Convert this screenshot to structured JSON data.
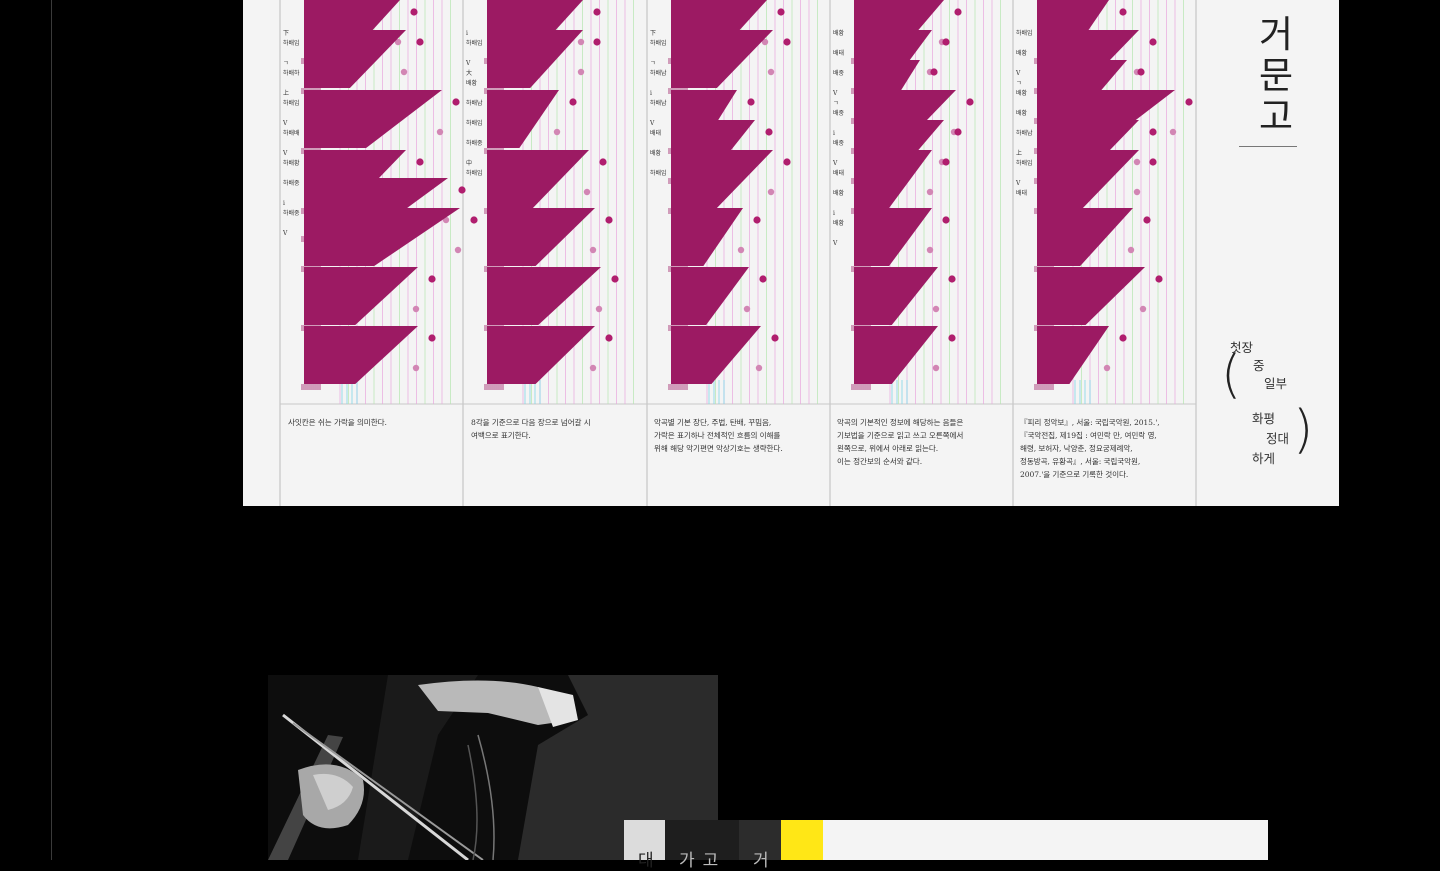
{
  "score": {
    "title_chars": [
      "거",
      "문",
      "고"
    ],
    "subtitle_chars": [
      "첫장",
      "중",
      "일부",
      "화평",
      "정대",
      "하게"
    ],
    "columns": [
      {
        "labels": [
          "下",
          "하배임",
          "ㄱ",
          "하배하",
          "上",
          "하배임",
          "V",
          "하배배",
          "V",
          "하배황",
          "하배중",
          "i",
          "하배중",
          "V"
        ],
        "note": "사잇칸은 쉬는 가락을 의미한다."
      },
      {
        "labels": [
          "i",
          "하배임",
          "V",
          "大",
          "배황",
          "하배남",
          "하배임",
          "하배중",
          "中",
          "하배임"
        ],
        "note": "8각을 기준으로 다음 장으로 넘어갈 시\n여백으로 표기한다."
      },
      {
        "labels": [
          "下",
          "하배임",
          "ㄱ",
          "하배남",
          "i",
          "하배남",
          "V",
          "배태",
          "배황",
          "하배임"
        ],
        "note": "악곡별 기본 장단, 주법, 탄배, 꾸밈음,\n가락은 표기하나 전체적인 흐름의 이해를\n위해 해당 악기편면 악상기호는 생략한다."
      },
      {
        "labels": [
          "배황",
          "배태",
          "배중",
          "V",
          "ㄱ",
          "배중",
          "i",
          "배중",
          "V",
          "배태",
          "배황",
          "i",
          "배황",
          "V"
        ],
        "note": "악곡의 기본적인 정보에 해당하는 음들은\n기보법을 기준으로 읽고 쓰고 오른쪽에서\n왼쪽으로, 위에서 아래로 읽는다.\n이는 정간보의 순서와 같다."
      },
      {
        "labels": [
          "하배임",
          "배황",
          "V",
          "ㄱ",
          "배황",
          "배황",
          "하배남",
          "上",
          "하배임",
          "V",
          "배태"
        ],
        "note": "『피리 정악보』, 서울: 국립국악원, 2015.',\n『국악전집, 제19집 : 여민락 만, 여민락 영,\n해령, 보허자, 낙양춘, 정요궁제례악,\n정동방곡, 유황곡』, 서울: 국립국악원,\n2007.'을 기준으로 기록한 것이다."
      }
    ]
  },
  "colors": {
    "sheet_bg": "#f4f4f4",
    "shape_fill": "#9c1a63",
    "dot_dark": "#b01e6e",
    "dot_light": "#d286b4",
    "grid_pink": "#e9a6dd",
    "grid_green": "#b6e6b0",
    "grid_cyan": "#7fd6e8",
    "accent_yellow": "#ffe716"
  },
  "photo": {
    "icon": "musician-with-bow-photo"
  },
  "tabs": [
    {
      "label": "대",
      "active": true
    },
    {
      "label": "가고",
      "active": false
    },
    {
      "label": "거",
      "active": false
    },
    {
      "label": "",
      "active": false
    }
  ]
}
